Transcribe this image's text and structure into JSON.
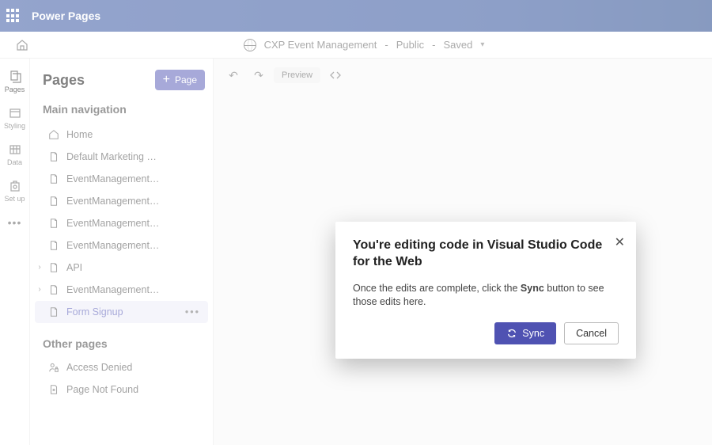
{
  "app_title": "Power Pages",
  "breadcrumb": {
    "site": "CXP Event Management",
    "visibility": "Public",
    "status": "Saved"
  },
  "sider": [
    {
      "label": "Pages"
    },
    {
      "label": "Styling"
    },
    {
      "label": "Data"
    },
    {
      "label": "Set up"
    }
  ],
  "panel": {
    "heading": "Pages",
    "add_btn": "Page",
    "main_nav_title": "Main navigation",
    "other_title": "Other pages",
    "items": [
      {
        "label": "Home",
        "icon": "home"
      },
      {
        "label": "Default Marketing …",
        "icon": "doc"
      },
      {
        "label": "EventManagement…",
        "icon": "doc"
      },
      {
        "label": "EventManagement…",
        "icon": "doc"
      },
      {
        "label": "EventManagement…",
        "icon": "doc"
      },
      {
        "label": "EventManagement…",
        "icon": "doc"
      },
      {
        "label": "API",
        "icon": "doc",
        "expandable": true
      },
      {
        "label": "EventManagement…",
        "icon": "doc",
        "expandable": true
      },
      {
        "label": "Form Signup",
        "icon": "doc",
        "selected": true
      }
    ],
    "other_items": [
      {
        "label": "Access Denied",
        "icon": "person-lock"
      },
      {
        "label": "Page Not Found",
        "icon": "doc-x"
      }
    ]
  },
  "toolbar": {
    "preview": "Preview"
  },
  "modal": {
    "title": "You're editing code in Visual Studio Code for the Web",
    "body_before": "Once the edits are complete, click the ",
    "body_bold": "Sync",
    "body_after": " button to see those edits here.",
    "sync": "Sync",
    "cancel": "Cancel"
  }
}
